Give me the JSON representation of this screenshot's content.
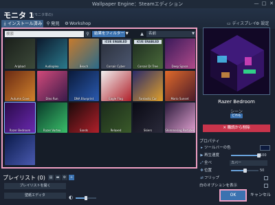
{
  "window": {
    "title": "Wallpaper Engine：Steamエディション",
    "controls": [
      "—",
      "□",
      "✕"
    ]
  },
  "header": {
    "monitor_title": "モニタ 1",
    "monitor_subtitle": "モニタ単の",
    "tabs": [
      {
        "icon": "download-icon",
        "label": "インストール済み",
        "active": true
      },
      {
        "icon": "search-icon",
        "label": "発見",
        "active": false
      },
      {
        "icon": "steam-icon",
        "label": "Workshop",
        "active": false
      }
    ],
    "display_label": "ディスプレイ",
    "settings_label": "設定"
  },
  "browser": {
    "search_placeholder": "検索",
    "filter_label": "結果をフィルター",
    "sort_label": "名前",
    "wallpapers": [
      {
        "name": "Aripbad",
        "colors": [
          "#1a1f1a",
          "#3d4a3a"
        ],
        "badge": ""
      },
      {
        "name": "Audioplex",
        "colors": [
          "#0c1a2e",
          "#2b7a8c"
        ],
        "badge": ""
      },
      {
        "name": "Beach",
        "colors": [
          "#c77a2c",
          "#2a6b8a"
        ],
        "badge": ""
      },
      {
        "name": "Corsair Cyber",
        "colors": [
          "#2a2f3a",
          "#4c5770"
        ],
        "badge": "iCUE ENABLED"
      },
      {
        "name": "Corsair Dr Tree",
        "colors": [
          "#1c2a1f",
          "#4a6a3a"
        ],
        "badge": "iCUE ENABLED"
      },
      {
        "name": "Deep Space",
        "colors": [
          "#3a1a5a",
          "#b04a8a"
        ],
        "badge": ""
      },
      {
        "name": "Autumn Cove",
        "colors": [
          "#6a2a14",
          "#d0822c"
        ],
        "badge": ""
      },
      {
        "name": "Dino Run",
        "colors": [
          "#d24a7a",
          "#3a1a4a"
        ],
        "badge": ""
      },
      {
        "name": "DNA Blueprint",
        "colors": [
          "#0a1a3a",
          "#2a5ab0"
        ],
        "badge": ""
      },
      {
        "name": "Eagle Flag",
        "colors": [
          "#f0f0f0",
          "#b0202a"
        ],
        "badge": ""
      },
      {
        "name": "Fantastic Car",
        "colors": [
          "#2a2a6a",
          "#e0a02a"
        ],
        "badge": ""
      },
      {
        "name": "Mario Sunset",
        "colors": [
          "#e06a2a",
          "#4a1a2a"
        ],
        "badge": ""
      },
      {
        "name": "Razer Bedroom",
        "colors": [
          "#2a0a4a",
          "#6a2ab0"
        ],
        "badge": ""
      },
      {
        "name": "Razer Vortex",
        "colors": [
          "#0a3a2a",
          "#3ac06a"
        ],
        "badge": ""
      },
      {
        "name": "Sands",
        "colors": [
          "#1a0a0a",
          "#b0202a"
        ],
        "badge": ""
      },
      {
        "name": "Relaxed",
        "colors": [
          "#1a2a1a",
          "#3a5a2a"
        ],
        "badge": ""
      },
      {
        "name": "Skiers",
        "colors": [
          "#0a0a14",
          "#2a2a3a"
        ],
        "badge": ""
      },
      {
        "name": "Shimmering Particles",
        "colors": [
          "#2a1a3a",
          "#e0a0d0"
        ],
        "badge": ""
      },
      {
        "name": "",
        "colors": [
          "#0a1a4a",
          "#4a5ab0"
        ],
        "badge": ""
      }
    ]
  },
  "details": {
    "name": "Razer Bedroom",
    "type": "シーン",
    "rating": "どれも",
    "unsubscribe_label": "✕ 購読から削除",
    "properties_title": "プロパティ",
    "props": {
      "toolbar_color": "ツールバーの色",
      "playback_speed": "再生速度",
      "playback_speed_value": "100",
      "all_label": "全べ",
      "all_value": "カバー",
      "position": "位置",
      "position_value": "50",
      "flip": "フリップ",
      "show_options": "白のオプションを表示"
    },
    "playback_speed_fraction": 1.0,
    "position_fraction": 0.5
  },
  "playlist": {
    "label": "プレイリスト (0)",
    "load_label": "プレイリストを開く",
    "edit_label": "壁紙エディタ",
    "brightness_fraction": 0.5
  },
  "footer": {
    "ok_label": "OK",
    "cancel_label": "キャンセル"
  },
  "colors": {
    "accent": "#3b72b0",
    "highlight_outline": "#f0a0c4",
    "danger": "#c9344b",
    "background": "#1b2230"
  }
}
